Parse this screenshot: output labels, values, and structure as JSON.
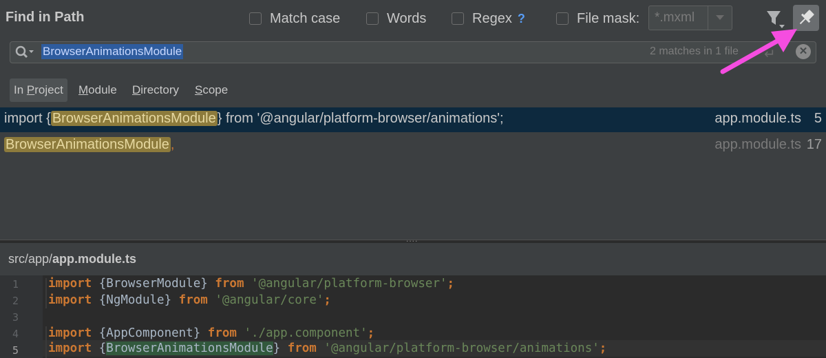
{
  "header": {
    "title": "Find in Path",
    "options": {
      "match_case": "Match case",
      "words": "Words",
      "regex": "Regex",
      "regex_help": "?",
      "file_mask": "File mask:"
    },
    "file_mask_value": "*.mxml"
  },
  "search": {
    "query": "BrowserAnimationsModule",
    "match_info": "2 matches in 1 file"
  },
  "scopes": {
    "in_project_pre": "In ",
    "in_project_u": "P",
    "in_project_post": "roject",
    "module_u": "M",
    "module_post": "odule",
    "directory_u": "D",
    "directory_post": "irectory",
    "scope_u": "S",
    "scope_post": "cope"
  },
  "results": [
    {
      "pre": "import {",
      "match": "BrowserAnimationsModule",
      "post": "} from '@angular/platform-browser/animations';",
      "file": "app.module.ts",
      "line": "5"
    },
    {
      "pre": "",
      "match": "BrowserAnimationsModule",
      "post": ",",
      "file": "app.module.ts",
      "line": "17"
    }
  ],
  "splitter_grip": "....",
  "preview": {
    "path_dir": "src/app/",
    "path_file": "app.module.ts",
    "lines": [
      {
        "num": "1",
        "kw1": "import",
        "a": " {BrowserModule} ",
        "kw2": "from",
        "b": " ",
        "str": "'@angular/platform-browser'",
        "end": ";"
      },
      {
        "num": "2",
        "kw1": "import",
        "a": " {NgModule} ",
        "kw2": "from",
        "b": " ",
        "str": "'@angular/core'",
        "end": ";"
      },
      {
        "num": "3"
      },
      {
        "num": "4",
        "kw1": "import",
        "a": " {AppComponent} ",
        "kw2": "from",
        "b": " ",
        "str": "'./app.component'",
        "end": ";"
      },
      {
        "num": "5",
        "kw1": "import",
        "a": " {",
        "id": "BrowserAnimationsModule",
        "a2": "} ",
        "kw2": "from",
        "b": " ",
        "str": "'@angular/platform-browser/animations'",
        "end": ";"
      }
    ]
  },
  "colors": {
    "accent_arrow": "#f54de0",
    "selection": "#2e5c9e",
    "match_highlight": "#8d7b3c",
    "selected_row": "#0d293e"
  },
  "icons": [
    "search-icon",
    "filter-icon",
    "pin-icon",
    "clear-icon",
    "newline-icon",
    "chevron-down-icon"
  ]
}
